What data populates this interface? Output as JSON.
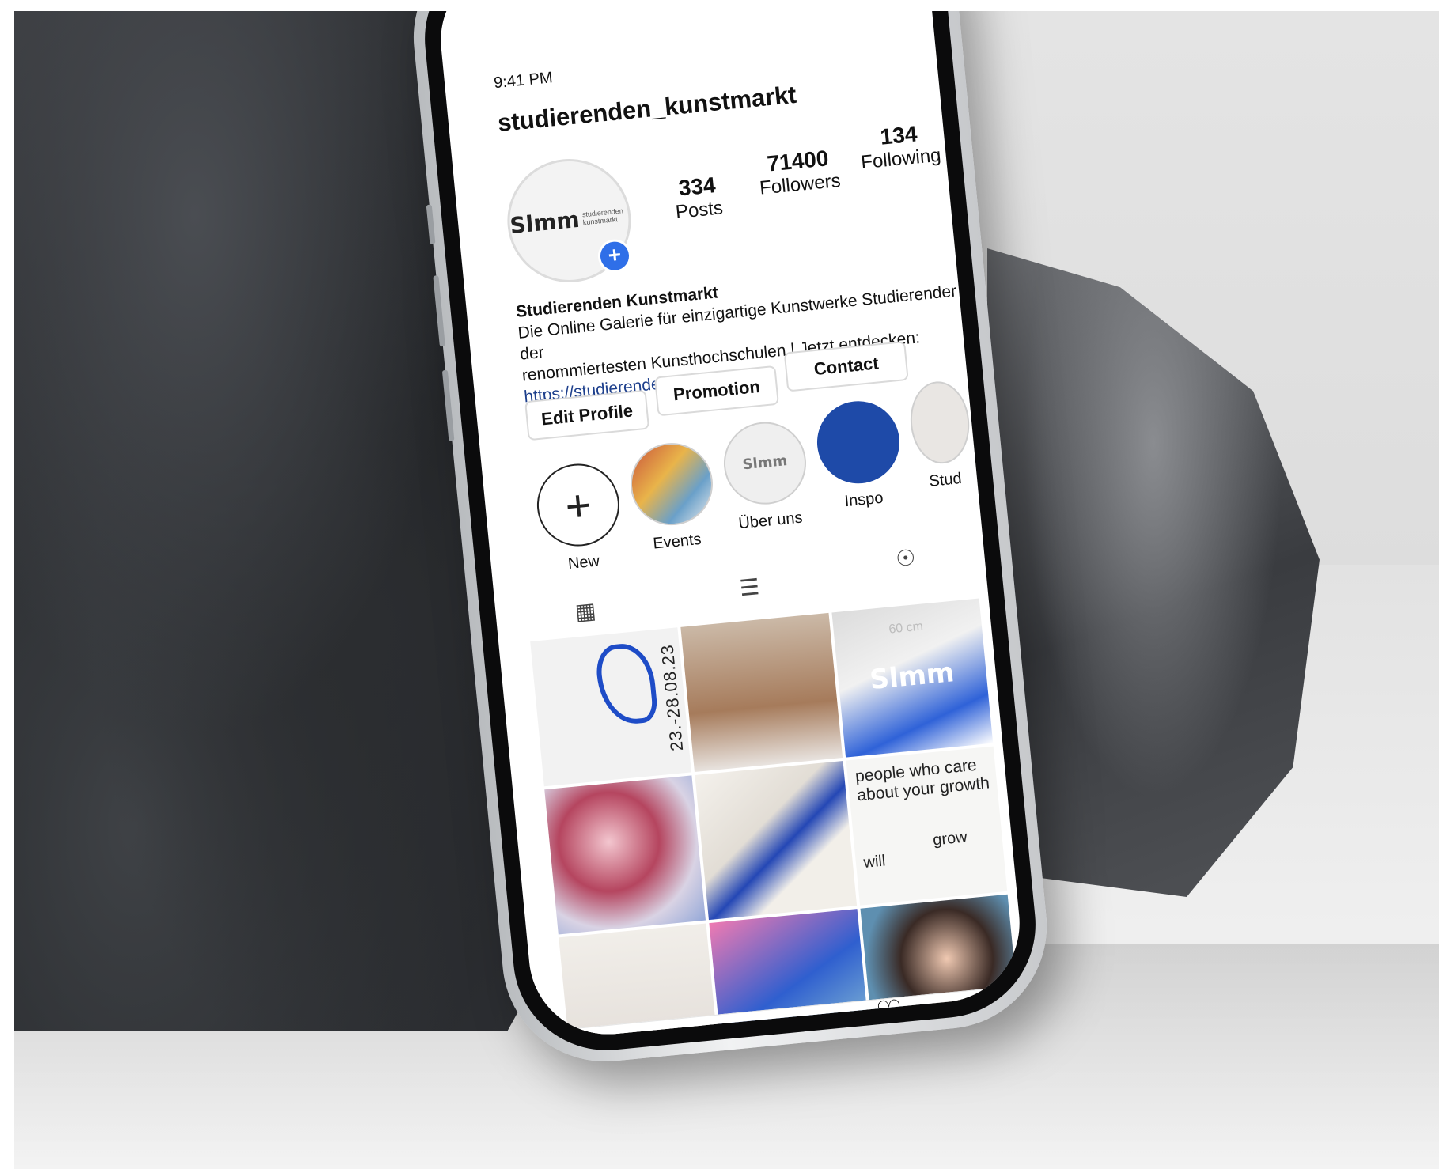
{
  "status": {
    "time": "9:41 PM"
  },
  "profile": {
    "username": "studierenden_kunstmarkt",
    "avatar_logo": "Slmm",
    "avatar_sub": "studierenden kunstmarkt",
    "stats": [
      {
        "number": "334",
        "label": "Posts"
      },
      {
        "number": "71400",
        "label": "Followers"
      },
      {
        "number": "134",
        "label": "Following"
      }
    ],
    "bio": {
      "name": "Studierenden Kunstmarkt",
      "line1": "Die Online Galerie für einzigartige Kunstwerke Studierender der",
      "line2": "renommiertesten Kunsthochschulen | Jetzt entdecken:",
      "link": "https://studierendenkunstmarkt.de"
    }
  },
  "buttons": {
    "edit": "Edit Profile",
    "promotion": "Promotion",
    "contact": "Contact"
  },
  "highlights": [
    {
      "label": "New"
    },
    {
      "label": "Events"
    },
    {
      "label": "Über uns"
    },
    {
      "label": "Inspo"
    },
    {
      "label": "Stud"
    }
  ],
  "posts": {
    "date_text": "23.-28.08.23",
    "tile3_logo": "Slmm",
    "tile3_size": "60 cm",
    "quote": "people who care about your growth",
    "word_will": "will",
    "word_grow": "grow"
  },
  "icons": {
    "grid": "grid-icon",
    "list": "list-icon",
    "tagged": "tagged-icon",
    "home": "home-icon",
    "search": "search-icon",
    "add": "add-post-icon",
    "heart": "heart-icon"
  },
  "colors": {
    "accent": "#2f6fe8",
    "link": "#1d3f8c",
    "inspo": "#1e4aa8"
  }
}
